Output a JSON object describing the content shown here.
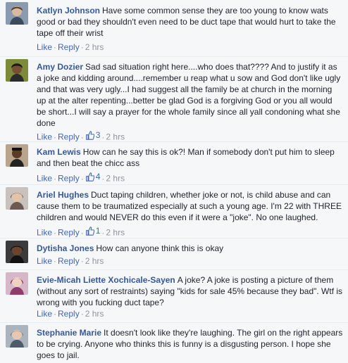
{
  "labels": {
    "like": "Like",
    "reply": "Reply",
    "separator": "·"
  },
  "colors": {
    "name_link": "#365899",
    "action_link": "#4267b2",
    "meta": "#90949c",
    "background": "#f6f7f9"
  },
  "comments": [
    {
      "author": "Katlyn Johnson",
      "text": "Have some common sense they are too young to know wats good or bad they shouldn't even need to be duct tape that would hurt to take the tape off their wrist",
      "likes": null,
      "time": "2 hrs"
    },
    {
      "author": "Amy Dozier",
      "text": "Sad sad situation right here....who does that???? And to justify it as a joke and kidding around....remember u reap what u sow and God don't like ugly and that was very ugly...I had suggest all the family be at church in the morning up at the alter repenting...better be glad God is a forgiving God or you all would be short...I will say a prayer for the whole family since all yall condoning what she done",
      "likes": "3",
      "time": "2 hrs"
    },
    {
      "author": "Kam Lewis",
      "text": "How can he say this is ok?! Man if somebody don't put him to sleep and then beat the chicc ass",
      "likes": "4",
      "time": "2 hrs"
    },
    {
      "author": "Ariel Hughes",
      "text": "Duct taping children, whether joke or not, is child abuse and can cause them to be traumatized especially at such a young age. I'm 22 with THREE children and would NEVER do this even if it were a \"joke\". No one laughed.",
      "likes": "1",
      "time": "2 hrs"
    },
    {
      "author": "Dytisha Jones",
      "text": "How can anyone think this is okay",
      "likes": null,
      "time": "2 hrs"
    },
    {
      "author": "Evie-Micah Liette Xochicale-Sayen",
      "text": "A joke? A joke is posting a picture of them (without any sort of restraints) saying \"kids for sale 45% because they bad\". Wtf is wrong with you fucking duct tape?",
      "likes": null,
      "time": "2 hrs"
    },
    {
      "author": "Stephanie Marie",
      "text": "It doesn't look like they're laughing. The girl on the right appears to be crying. Anyone who thinks this is funny is a disgusting person. I hope she goes to jail.",
      "likes": null,
      "time": null
    }
  ]
}
